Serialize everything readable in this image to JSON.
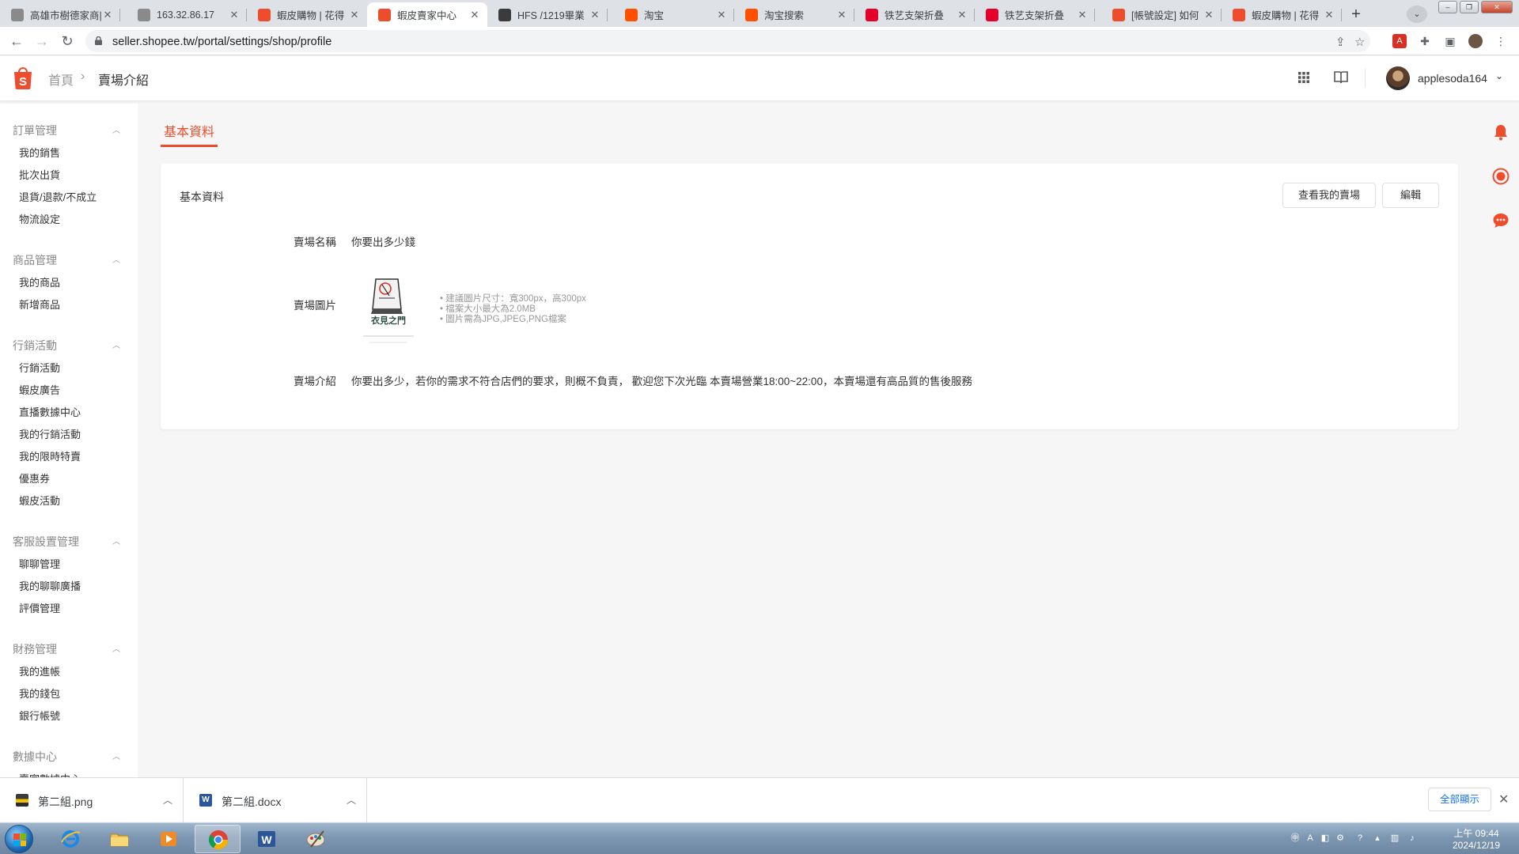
{
  "browser": {
    "tabs": [
      {
        "title": "高雄市樹德家商|",
        "icon": "globe-icon",
        "color": "#8a8a8a"
      },
      {
        "title": "163.32.86.17",
        "icon": "globe-icon",
        "color": "#8a8a8a"
      },
      {
        "title": "蝦皮購物 | 花得",
        "icon": "shopee-bag-icon",
        "color": "#ee4d2d"
      },
      {
        "title": "蝦皮賣家中心",
        "icon": "shopee-bag-icon",
        "color": "#ee4d2d",
        "active": true
      },
      {
        "title": "HFS /1219畢業",
        "icon": "hfs-icon",
        "color": "#3b3b3b"
      },
      {
        "title": "淘宝",
        "icon": "taobao-icon",
        "color": "#ff5000"
      },
      {
        "title": "淘宝搜索",
        "icon": "taobao-icon",
        "color": "#ff5000"
      },
      {
        "title": "铁艺支架折叠",
        "icon": "tmall-icon",
        "color": "#e4002b"
      },
      {
        "title": "铁艺支架折叠",
        "icon": "tmall-icon",
        "color": "#e4002b"
      },
      {
        "title": "[帳號設定] 如何",
        "icon": "shopee-bag-icon",
        "color": "#ee4d2d"
      },
      {
        "title": "蝦皮購物 | 花得",
        "icon": "shopee-bag-icon",
        "color": "#ee4d2d"
      }
    ],
    "url": "seller.shopee.tw/portal/settings/shop/profile"
  },
  "header": {
    "breadcrumb_home": "首頁",
    "breadcrumb_sep": "›",
    "breadcrumb_current": "賣場介紹",
    "username": "applesoda164",
    "brand_color": "#ee4d2d"
  },
  "sidebar": {
    "groups": [
      {
        "title": "訂單管理",
        "items": [
          "我的銷售",
          "批次出貨",
          "退貨/退款/不成立",
          "物流設定"
        ]
      },
      {
        "title": "商品管理",
        "items": [
          "我的商品",
          "新增商品"
        ]
      },
      {
        "title": "行銷活動",
        "items": [
          "行銷活動",
          "蝦皮廣告",
          "直播數據中心",
          "我的行銷活動",
          "我的限時特賣",
          "優惠券",
          "蝦皮活動"
        ]
      },
      {
        "title": "客服設置管理",
        "items": [
          "聊聊管理",
          "我的聊聊廣播",
          "評價管理"
        ]
      },
      {
        "title": "財務管理",
        "items": [
          "我的進帳",
          "我的錢包",
          "銀行帳號"
        ]
      },
      {
        "title": "數據中心",
        "items": [
          "賣家數據中心"
        ]
      }
    ]
  },
  "main": {
    "tab_label": "基本資料",
    "card_title": "基本資料",
    "view_shop_button": "查看我的賣場",
    "edit_button": "編輯",
    "shop_name_label": "賣場名稱",
    "shop_name_value": "你要出多少錢",
    "shop_image_label": "賣場圖片",
    "shop_logo_text": "衣見之門",
    "image_hints": [
      "• 建議圖片尺寸：寬300px，高300px",
      "• 檔案大小最大為2.0MB",
      "• 圖片需為JPG,JPEG,PNG檔案"
    ],
    "shop_desc_label": "賣場介紹",
    "shop_desc_value": "你要出多少，若你的需求不符合店們的要求，則概不負責， 歡迎您下次光臨 本賣場營業18:00~22:00，本賣場還有高品質的售後服務"
  },
  "downloads": {
    "items": [
      {
        "name": "第二組.png",
        "icon": "image-file-icon"
      },
      {
        "name": "第二組.docx",
        "icon": "word-file-icon"
      }
    ],
    "show_all": "全部顯示"
  },
  "taskbar": {
    "time": "上午 09:44",
    "date": "2024/12/19"
  }
}
